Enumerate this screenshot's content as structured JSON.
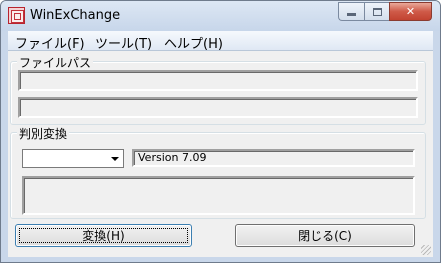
{
  "window": {
    "title": "WinExChange",
    "controls": {
      "minimize": "–",
      "maximize": "□",
      "close": "✕"
    }
  },
  "menu": [
    {
      "label": "ファイル(F)"
    },
    {
      "label": "ツール(T)"
    },
    {
      "label": "ヘルプ(H)"
    }
  ],
  "file_path_group": {
    "label": "ファイルパス",
    "path1": "",
    "path2": ""
  },
  "detect_group": {
    "label": "判別変換",
    "select_value": "",
    "version": "Version 7.09",
    "result": ""
  },
  "buttons": {
    "convert": "変換(H)",
    "close": "閉じる(C)"
  }
}
